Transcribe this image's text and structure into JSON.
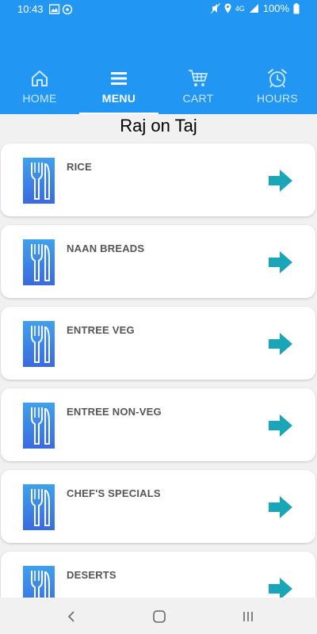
{
  "status_bar": {
    "time": "10:43",
    "battery": "100%",
    "network": "4G",
    "icons": [
      "image-icon",
      "vpn-icon",
      "mute-icon",
      "location-icon",
      "signal-icon",
      "battery-icon"
    ]
  },
  "tabs": [
    {
      "label": "HOME",
      "icon": "home-icon",
      "active": false
    },
    {
      "label": "MENU",
      "icon": "menu-icon",
      "active": true
    },
    {
      "label": "CART",
      "icon": "cart-icon",
      "active": false
    },
    {
      "label": "HOURS",
      "icon": "alarm-clock-icon",
      "active": false
    }
  ],
  "restaurant_name": "Raj on Taj",
  "categories": [
    {
      "label": "RICE",
      "icon": "utensils-icon",
      "action_icon": "arrow-right-icon"
    },
    {
      "label": "NAAN BREADS",
      "icon": "utensils-icon",
      "action_icon": "arrow-right-icon"
    },
    {
      "label": "ENTREE VEG",
      "icon": "utensils-icon",
      "action_icon": "arrow-right-icon"
    },
    {
      "label": "ENTREE NON-VEG",
      "icon": "utensils-icon",
      "action_icon": "arrow-right-icon"
    },
    {
      "label": "CHEF'S SPECIALS",
      "icon": "utensils-icon",
      "action_icon": "arrow-right-icon"
    },
    {
      "label": "DESERTS",
      "icon": "utensils-icon",
      "action_icon": "arrow-right-icon"
    }
  ],
  "colors": {
    "primary": "#2196F3",
    "arrow": "#1AA5B8",
    "icon_tile": "#3D7BE8",
    "label_text": "#555555",
    "background": "#F1F1F1"
  },
  "system_nav": [
    "back-icon",
    "home-circle-icon",
    "recent-apps-icon"
  ]
}
